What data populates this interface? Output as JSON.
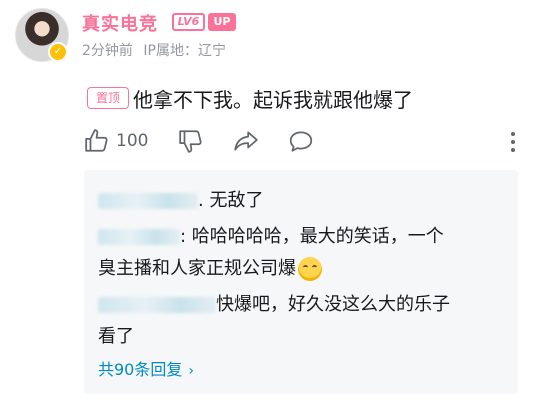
{
  "post": {
    "username": "真实电竞",
    "level_badge": "LV6",
    "up_badge": "UP",
    "time_ago": "2分钟前",
    "ip_location": "IP属地：辽宁",
    "pin_label": "置顶",
    "comment": "他拿不下我。起诉我就跟他爆了",
    "like_count": "100"
  },
  "replies": [
    {
      "suffix": ". 无敌了"
    },
    {
      "suffix": ": 哈哈哈哈哈，最大的笑话，一个",
      "continuation": "臭主播和人家正规公司爆"
    },
    {
      "suffix": "快爆吧，好久没这么大的乐子",
      "continuation": "看了"
    }
  ],
  "view_all": "共90条回复",
  "colors": {
    "brand_pink": "#fb7299",
    "link_blue": "#008ac5",
    "meta_gray": "#9499a0",
    "reply_bg": "#f6f7f8"
  },
  "icons": [
    "thumbs-up-icon",
    "thumbs-down-icon",
    "share-icon",
    "comment-icon",
    "more-vertical-icon",
    "chevron-right-icon",
    "laugh-cry-emoji"
  ]
}
